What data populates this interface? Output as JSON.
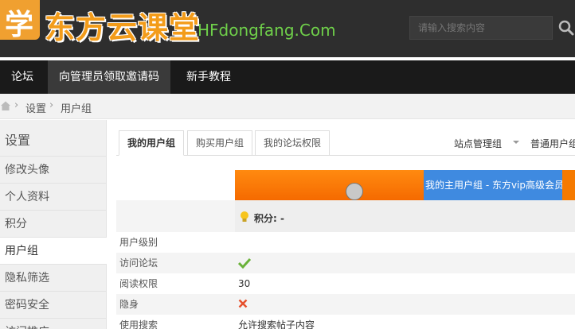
{
  "header": {
    "logo_char": "学",
    "brand": "东方云课堂",
    "domain": "HFdongfang.Com",
    "search_placeholder": "请输入搜索内容"
  },
  "nav": {
    "items": [
      {
        "label": "论坛"
      },
      {
        "label": "向管理员领取邀请码"
      },
      {
        "label": "新手教程"
      }
    ]
  },
  "breadcrumb": {
    "items": [
      "设置",
      "用户组"
    ],
    "separator": "›"
  },
  "sidebar": {
    "title": "设置",
    "items": [
      {
        "label": "修改头像"
      },
      {
        "label": "个人资料"
      },
      {
        "label": "积分"
      },
      {
        "label": "用户组"
      },
      {
        "label": "隐私筛选"
      },
      {
        "label": "密码安全"
      },
      {
        "label": "访问推广"
      }
    ]
  },
  "tabs": [
    {
      "label": "我的用户组"
    },
    {
      "label": "购买用户组"
    },
    {
      "label": "我的论坛权限"
    }
  ],
  "right_links": {
    "site_admin": "站点管理组",
    "normal_group": "普通用户组"
  },
  "progress": {
    "group_label": "我的主用户组 - 东方vip高级会员"
  },
  "points": {
    "label": "积分: -"
  },
  "table": {
    "rows": [
      {
        "label": "用户级别",
        "value": ""
      },
      {
        "label": "访问论坛",
        "value": ""
      },
      {
        "label": "阅读权限",
        "value": "30"
      },
      {
        "label": "隐身",
        "value": ""
      },
      {
        "label": "使用搜索",
        "value": "允许搜索帖子内容"
      }
    ]
  },
  "colors": {
    "accent_orange": "#f57a00",
    "group_blue": "#3f8ae0",
    "domain_green": "#6fd04a",
    "check_green": "#6ab23a",
    "cross_red": "#e6502d"
  }
}
